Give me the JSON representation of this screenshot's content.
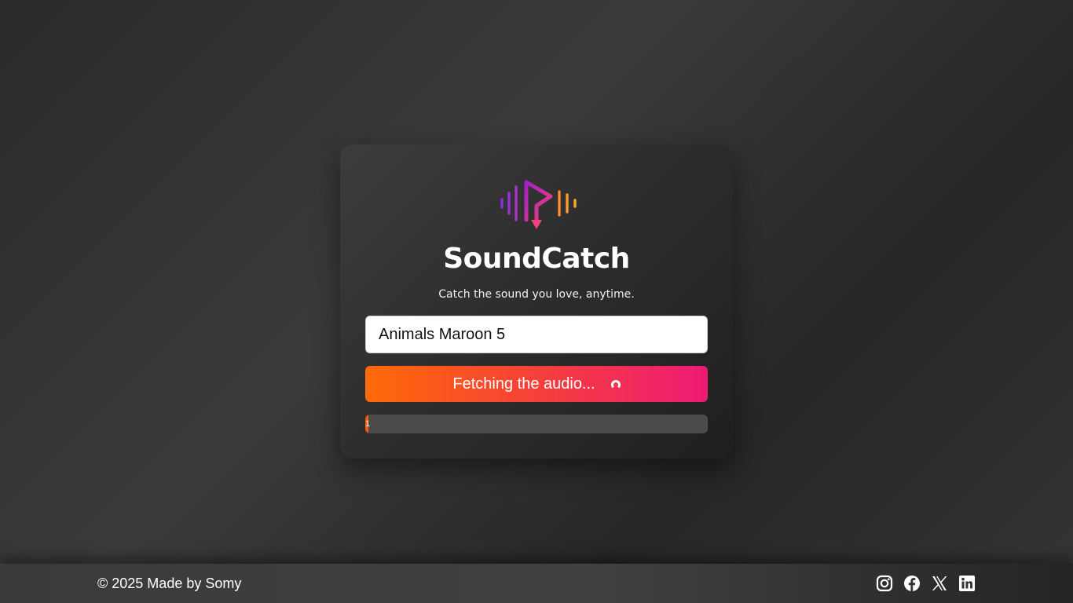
{
  "app": {
    "title": "SoundCatch",
    "tagline": "Catch the sound you love, anytime."
  },
  "search": {
    "value": "Animals Maroon 5",
    "placeholder": ""
  },
  "fetch_button": {
    "label": "Fetching the audio...",
    "state": "loading"
  },
  "progress": {
    "label": "1",
    "percent": 1
  },
  "footer": {
    "copyright": "© 2025 Made by Somy",
    "social_icons": [
      "instagram-icon",
      "facebook-icon",
      "x-icon",
      "linkedin-icon"
    ]
  },
  "colors": {
    "accent_orange": "#ff6a08",
    "accent_pink": "#ee1a75",
    "logo_purple": "#8e2de2"
  }
}
